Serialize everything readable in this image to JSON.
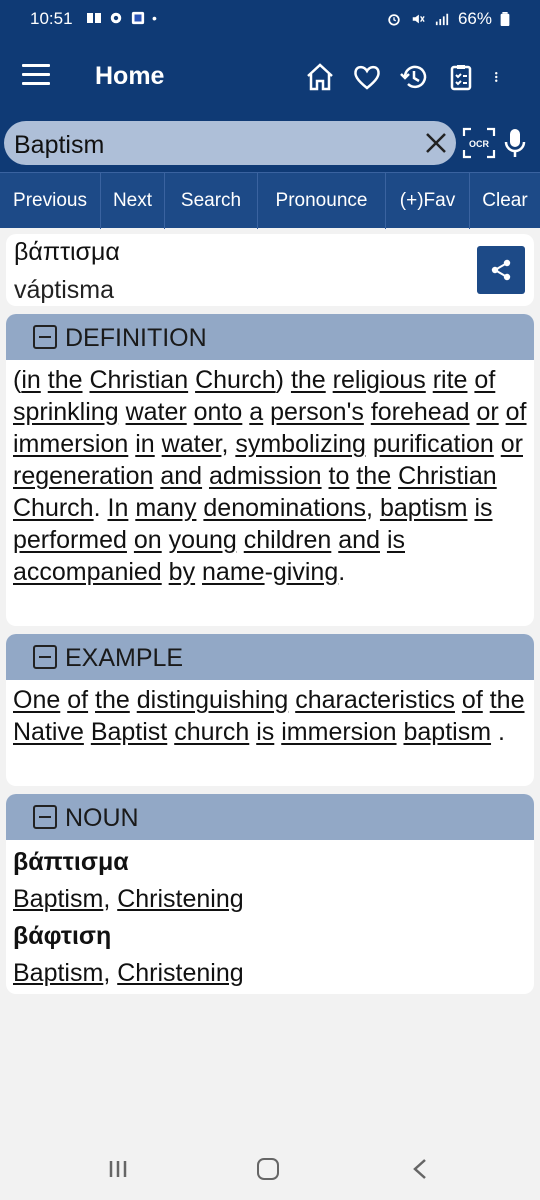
{
  "status": {
    "time": "10:51",
    "battery": "66%"
  },
  "appbar": {
    "title": "Home"
  },
  "search": {
    "value": "Baptism"
  },
  "toolbar": {
    "previous": "Previous",
    "next": "Next",
    "search": "Search",
    "pronounce": "Pronounce",
    "fav": "(+)Fav",
    "clear": "Clear"
  },
  "entry": {
    "word": "βάπτισμα",
    "transliteration": "váptisma"
  },
  "definition": {
    "header": "DEFINITION",
    "parts": [
      {
        "t": "(",
        "u": false
      },
      {
        "t": "in",
        "u": true
      },
      {
        "t": " ",
        "u": false
      },
      {
        "t": "the",
        "u": true
      },
      {
        "t": " ",
        "u": false
      },
      {
        "t": "Christian",
        "u": true
      },
      {
        "t": " ",
        "u": false
      },
      {
        "t": "Church",
        "u": true
      },
      {
        "t": ") ",
        "u": false
      },
      {
        "t": "the",
        "u": true
      },
      {
        "t": " ",
        "u": false
      },
      {
        "t": "religious",
        "u": true
      },
      {
        "t": " ",
        "u": false
      },
      {
        "t": "rite",
        "u": true
      },
      {
        "t": " ",
        "u": false
      },
      {
        "t": "of",
        "u": true
      },
      {
        "t": " ",
        "u": false
      },
      {
        "t": "sprinkling",
        "u": true
      },
      {
        "t": " ",
        "u": false
      },
      {
        "t": "water",
        "u": true
      },
      {
        "t": " ",
        "u": false
      },
      {
        "t": "onto",
        "u": true
      },
      {
        "t": " ",
        "u": false
      },
      {
        "t": "a",
        "u": true
      },
      {
        "t": " ",
        "u": false
      },
      {
        "t": "person's",
        "u": true
      },
      {
        "t": " ",
        "u": false
      },
      {
        "t": "forehead",
        "u": true
      },
      {
        "t": " ",
        "u": false
      },
      {
        "t": "or",
        "u": true
      },
      {
        "t": " ",
        "u": false
      },
      {
        "t": "of",
        "u": true
      },
      {
        "t": " ",
        "u": false
      },
      {
        "t": "immersion",
        "u": true
      },
      {
        "t": " ",
        "u": false
      },
      {
        "t": "in",
        "u": true
      },
      {
        "t": " ",
        "u": false
      },
      {
        "t": "water",
        "u": true
      },
      {
        "t": ", ",
        "u": false
      },
      {
        "t": "symbolizing",
        "u": true
      },
      {
        "t": " ",
        "u": false
      },
      {
        "t": "purification",
        "u": true
      },
      {
        "t": " ",
        "u": false
      },
      {
        "t": "or",
        "u": true
      },
      {
        "t": " ",
        "u": false
      },
      {
        "t": "regeneration",
        "u": true
      },
      {
        "t": " ",
        "u": false
      },
      {
        "t": "and",
        "u": true
      },
      {
        "t": " ",
        "u": false
      },
      {
        "t": "admission",
        "u": true
      },
      {
        "t": " ",
        "u": false
      },
      {
        "t": "to",
        "u": true
      },
      {
        "t": " ",
        "u": false
      },
      {
        "t": "the",
        "u": true
      },
      {
        "t": " ",
        "u": false
      },
      {
        "t": "Christian",
        "u": true
      },
      {
        "t": " ",
        "u": false
      },
      {
        "t": "Church",
        "u": true
      },
      {
        "t": ". ",
        "u": false
      },
      {
        "t": "In",
        "u": true
      },
      {
        "t": " ",
        "u": false
      },
      {
        "t": "many",
        "u": true
      },
      {
        "t": " ",
        "u": false
      },
      {
        "t": "denominations",
        "u": true
      },
      {
        "t": ", ",
        "u": false
      },
      {
        "t": "baptism",
        "u": true
      },
      {
        "t": " ",
        "u": false
      },
      {
        "t": "is",
        "u": true
      },
      {
        "t": " ",
        "u": false
      },
      {
        "t": "performed",
        "u": true
      },
      {
        "t": " ",
        "u": false
      },
      {
        "t": "on",
        "u": true
      },
      {
        "t": " ",
        "u": false
      },
      {
        "t": "young",
        "u": true
      },
      {
        "t": " ",
        "u": false
      },
      {
        "t": "children",
        "u": true
      },
      {
        "t": " ",
        "u": false
      },
      {
        "t": "and",
        "u": true
      },
      {
        "t": " ",
        "u": false
      },
      {
        "t": "is",
        "u": true
      },
      {
        "t": " ",
        "u": false
      },
      {
        "t": "accompanied",
        "u": true
      },
      {
        "t": " ",
        "u": false
      },
      {
        "t": "by",
        "u": true
      },
      {
        "t": " ",
        "u": false
      },
      {
        "t": "name",
        "u": true
      },
      {
        "t": "-",
        "u": false
      },
      {
        "t": "giving",
        "u": true
      },
      {
        "t": ".",
        "u": false
      }
    ]
  },
  "example": {
    "header": "EXAMPLE",
    "parts": [
      {
        "t": "One",
        "u": true
      },
      {
        "t": " ",
        "u": false
      },
      {
        "t": "of",
        "u": true
      },
      {
        "t": " ",
        "u": false
      },
      {
        "t": "the",
        "u": true
      },
      {
        "t": " ",
        "u": false
      },
      {
        "t": "distinguishing",
        "u": true
      },
      {
        "t": " ",
        "u": false
      },
      {
        "t": "characteristics",
        "u": true
      },
      {
        "t": " ",
        "u": false
      },
      {
        "t": "of",
        "u": true
      },
      {
        "t": " ",
        "u": false
      },
      {
        "t": "the",
        "u": true
      },
      {
        "t": " ",
        "u": false
      },
      {
        "t": "Native",
        "u": true
      },
      {
        "t": " ",
        "u": false
      },
      {
        "t": "Baptist",
        "u": true
      },
      {
        "t": " ",
        "u": false
      },
      {
        "t": "church",
        "u": true
      },
      {
        "t": " ",
        "u": false
      },
      {
        "t": "is",
        "u": true
      },
      {
        "t": " ",
        "u": false
      },
      {
        "t": "immersion",
        "u": true
      },
      {
        "t": " ",
        "u": false
      },
      {
        "t": "baptism",
        "u": true
      },
      {
        "t": " .",
        "u": false
      }
    ]
  },
  "noun": {
    "header": "NOUN",
    "entries": [
      {
        "greek": "βάπτισμα",
        "translations": [
          "Baptism",
          "Christening"
        ]
      },
      {
        "greek": "βάφτιση",
        "translations": [
          "Baptism",
          "Christening"
        ]
      }
    ]
  }
}
